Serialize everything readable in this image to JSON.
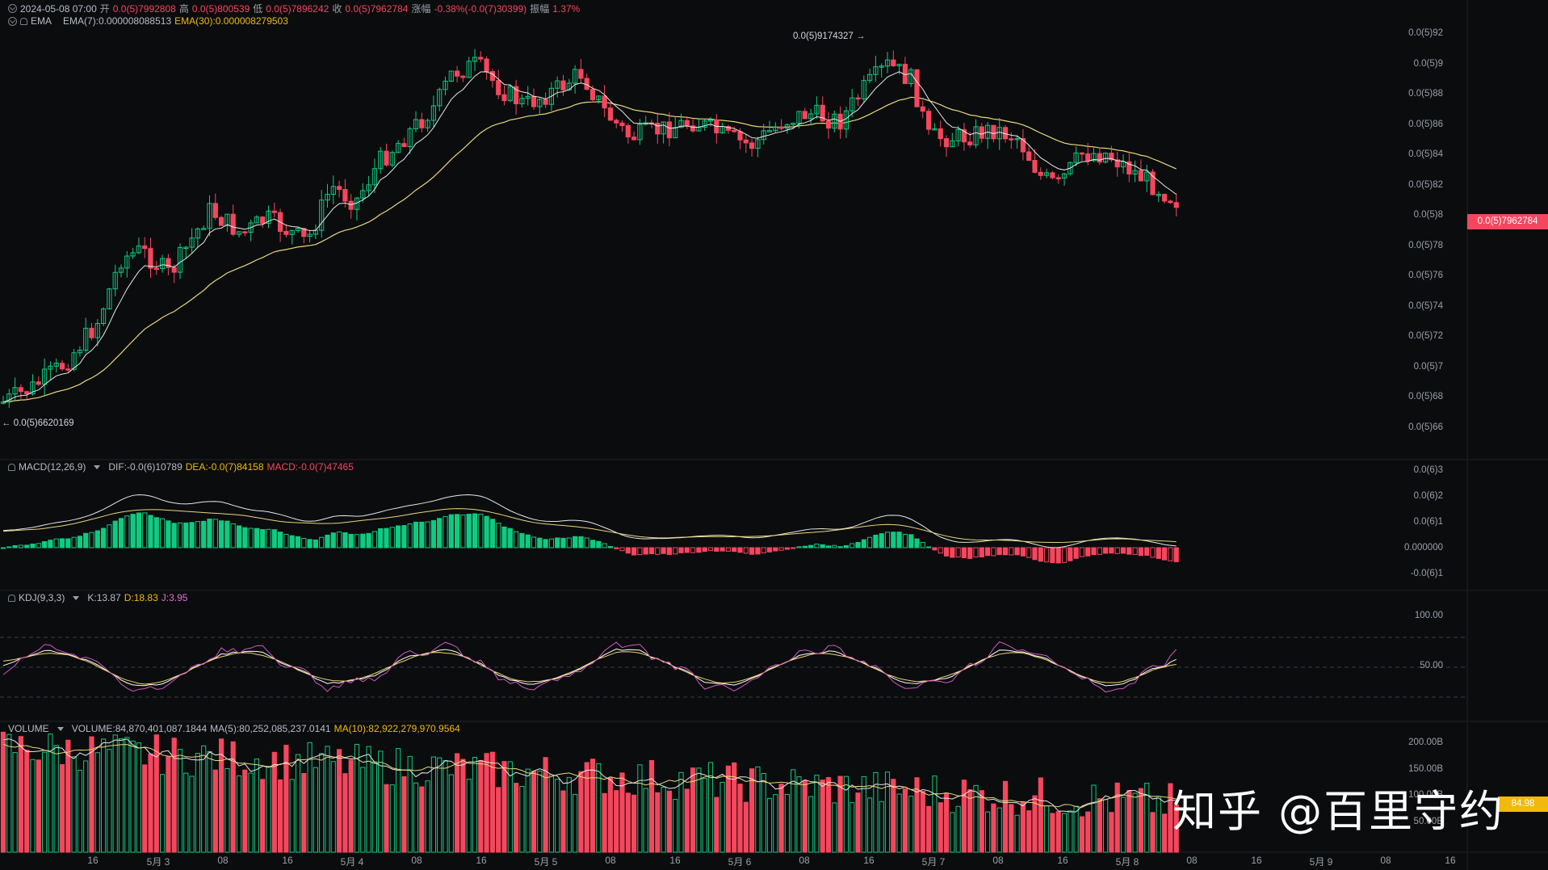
{
  "header": {
    "timestamp": "2024-05-08 07:00",
    "open_label": "开",
    "open_value": "0.0(5)7992808",
    "high_label": "高",
    "high_value": "0.0(5)800539",
    "low_label": "低",
    "low_value": "0.0(5)7896242",
    "close_label": "收",
    "close_value": "0.0(5)7962784",
    "change_label": "涨幅",
    "change_value": "-0.38%(-0.0(7)30399)",
    "amplitude_label": "振幅",
    "amplitude_value": "1.37%"
  },
  "ema": {
    "name": "EMA",
    "ema7": "EMA(7):0.000008088513",
    "ema30": "EMA(30):0.000008279503"
  },
  "macd": {
    "name": "MACD(12,26,9)",
    "dif": "DIF:-0.0(6)10789",
    "dea": "DEA:-0.0(7)84158",
    "macd": "MACD:-0.0(7)47465",
    "axis": [
      "0.0(6)3",
      "0.0(6)2",
      "0.0(6)1",
      "0.000000",
      "-0.0(6)1"
    ]
  },
  "kdj": {
    "name": "KDJ(9,3,3)",
    "k": "K:13.87",
    "d": "D:18.83",
    "j": "J:3.95",
    "axis": [
      "100.00",
      "50.00"
    ]
  },
  "volume": {
    "name": "VOLUME",
    "volume": "VOLUME:84,870,401,087.1844",
    "ma5": "MA(5):80,252,085,237.0141",
    "ma10": "MA(10):82,922,279,970.9564",
    "axis": [
      "200.00B",
      "150.00B",
      "100.00B",
      "50.00B"
    ],
    "current_tag": "84.98"
  },
  "price_axis": [
    "0.0(5)92",
    "0.0(5)9",
    "0.0(5)88",
    "0.0(5)86",
    "0.0(5)84",
    "0.0(5)82",
    "0.0(5)8",
    "0.0(5)78",
    "0.0(5)76",
    "0.0(5)74",
    "0.0(5)72",
    "0.0(5)7",
    "0.0(5)68",
    "0.0(5)66"
  ],
  "current_price_tag": "0.0(5)7962784",
  "high_marker": "0.0(5)9174327",
  "low_marker": "0.0(5)6620169",
  "x_axis": [
    "16",
    "5月 3",
    "08",
    "16",
    "5月 4",
    "08",
    "16",
    "5月 5",
    "08",
    "16",
    "5月 6",
    "08",
    "16",
    "5月 7",
    "08",
    "16",
    "5月 8",
    "08",
    "16",
    "5月 9",
    "08",
    "16"
  ],
  "watermark": "知乎 @百里守约",
  "colors": {
    "up": "#0ecb81",
    "down": "#f6465d",
    "ema7": "#e8e8e8",
    "ema30": "#e9d77a",
    "accent": "#f0b90b",
    "k": "#ffffff",
    "d": "#f0d56b",
    "j": "#d25ac1"
  },
  "chart_data": {
    "type": "candlestick",
    "series": [
      {
        "name": "EMA(7)"
      },
      {
        "name": "EMA(30)"
      }
    ]
  }
}
